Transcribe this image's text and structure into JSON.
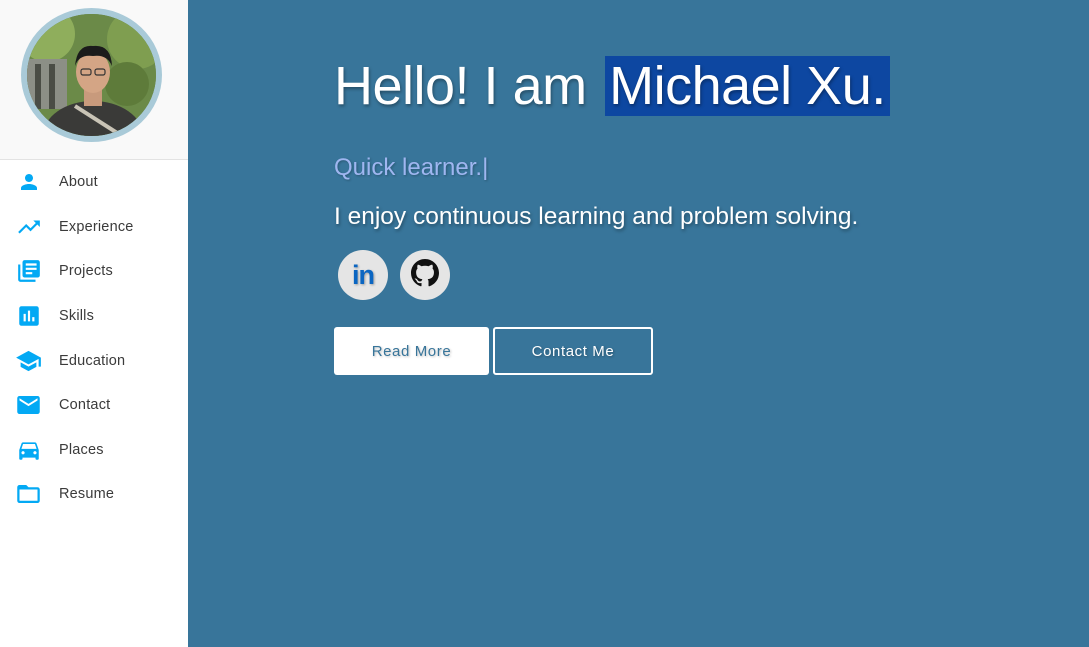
{
  "sidebar": {
    "items": [
      {
        "label": "About",
        "icon": "person-icon"
      },
      {
        "label": "Experience",
        "icon": "trending-up-icon"
      },
      {
        "label": "Projects",
        "icon": "library-books-icon"
      },
      {
        "label": "Skills",
        "icon": "bar-chart-icon"
      },
      {
        "label": "Education",
        "icon": "graduation-cap-icon"
      },
      {
        "label": "Contact",
        "icon": "mail-icon"
      },
      {
        "label": "Places",
        "icon": "car-icon"
      },
      {
        "label": "Resume",
        "icon": "folder-icon"
      }
    ]
  },
  "hero": {
    "greeting": "Hello! I am",
    "name": "Michael Xu.",
    "typed_text": "Quick learner.",
    "cursor": "|",
    "tagline": "I enjoy continuous learning and problem solving.",
    "linkedin_label": "in",
    "read_more_label": "Read More",
    "contact_label": "Contact Me"
  },
  "colors": {
    "accent_blue": "#03a9f4",
    "hero_background": "#38759a",
    "name_highlight": "#0d47a1",
    "avatar_border": "#a9cad8"
  }
}
